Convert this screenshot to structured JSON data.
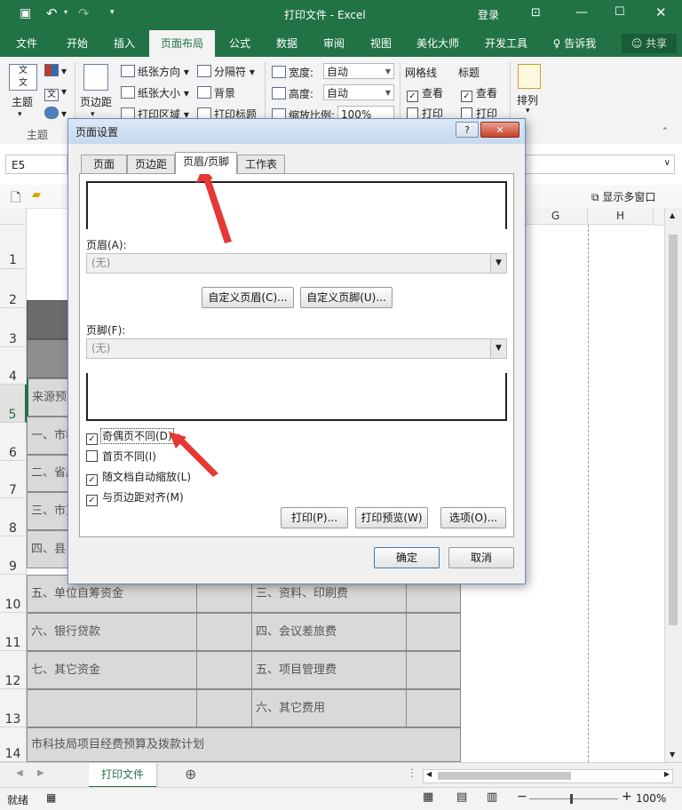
{
  "titlebar": {
    "title": "打印文件 - Excel",
    "login": "登录",
    "save_icon": "save-icon",
    "undo_icon": "undo-icon",
    "redo_icon": "redo-icon"
  },
  "tabs": [
    "文件",
    "开始",
    "插入",
    "页面布局",
    "公式",
    "数据",
    "审阅",
    "视图",
    "美化大师",
    "开发工具"
  ],
  "tell_me": "告诉我",
  "share": "共享",
  "ribbon": {
    "theme_label": "主题",
    "margins_label": "页边距",
    "orientation": "纸张方向",
    "size": "纸张大小",
    "print_area": "打印区域",
    "breaks": "分隔符",
    "background": "背景",
    "print_titles": "打印标题",
    "width_label": "宽度:",
    "width_value": "自动",
    "height_label": "高度:",
    "height_value": "自动",
    "scale_label": "缩放比例:",
    "scale_value": "100%",
    "gridlines_label": "网格线",
    "headings_label": "标题",
    "view_label": "查看",
    "print_label": "打印",
    "arrange_label": "排列",
    "group_theme": "主题"
  },
  "formula": {
    "namebox": "E5"
  },
  "sheet_toolbar": {
    "show_windows": "显示多窗口"
  },
  "columns": [
    "G",
    "H"
  ],
  "rows": [
    "1",
    "2",
    "3",
    "4",
    "5",
    "6",
    "7",
    "8",
    "9",
    "10",
    "11",
    "12",
    "13",
    "14"
  ],
  "cells": {
    "r5": "来源预算",
    "r6": "一、市科",
    "r7": "二、省属",
    "r8": "三、市直",
    "r9": "四、县",
    "r10a": "五、单位自筹资金",
    "r10b": "三、资料、印刷费",
    "r11a": "六、银行贷款",
    "r11b": "四、会议差旅费",
    "r12a": "七、其它资金",
    "r12b": "五、项目管理费",
    "r13b": "六、其它费用",
    "r14": "市科技局项目经费预算及拨款计划"
  },
  "sheet_tab": "打印文件",
  "status": {
    "ready": "就绪",
    "zoom": "100%"
  },
  "dialog": {
    "title": "页面设置",
    "help": "?",
    "close": "✕",
    "tabs": [
      "页面",
      "页边距",
      "页眉/页脚",
      "工作表"
    ],
    "header_label": "页眉(A):",
    "header_value": "(无)",
    "custom_header": "自定义页眉(C)...",
    "custom_footer": "自定义页脚(U)...",
    "footer_label": "页脚(F):",
    "footer_value": "(无)",
    "chk_odd_even": "奇偶页不同(D)",
    "chk_first": "首页不同(I)",
    "chk_scale": "随文档自动缩放(L)",
    "chk_align": "与页边距对齐(M)",
    "btn_print": "打印(P)...",
    "btn_preview": "打印预览(W)",
    "btn_options": "选项(O)...",
    "btn_ok": "确定",
    "btn_cancel": "取消"
  },
  "colors": {
    "excel_green": "#217346",
    "arrow_red": "#e53935"
  }
}
